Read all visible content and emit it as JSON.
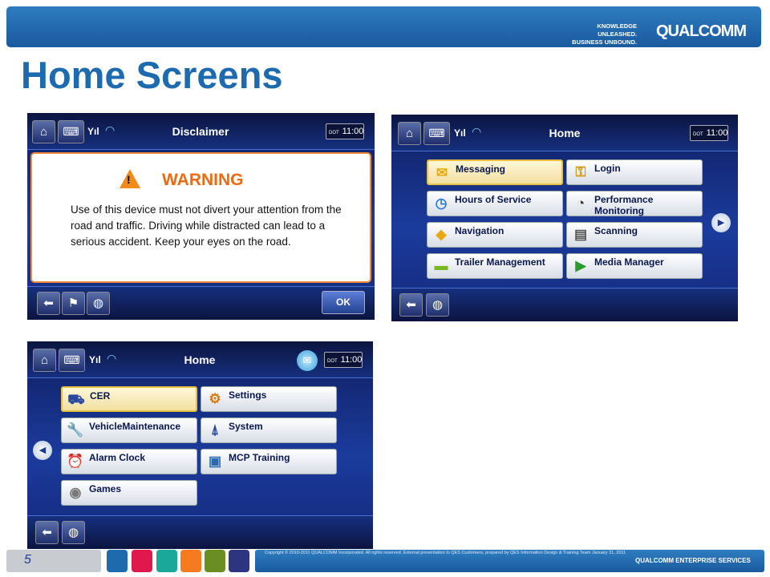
{
  "header": {
    "tagline_1": "KNOWLEDGE UNLEASHED.",
    "tagline_2": "BUSINESS UNBOUND.",
    "logo": "QUALCOMM"
  },
  "title": "Home Screens",
  "status": {
    "dot": "DOT",
    "time": "11:00"
  },
  "disclaimer": {
    "title": "Disclaimer",
    "warning_title": "WARNING",
    "warning_body": "Use of this device must not divert your attention from the road and traffic.  Driving while distracted can lead to a serious accident.  Keep your eyes on the road.",
    "ok_label": "OK"
  },
  "home1": {
    "title": "Home",
    "tiles": [
      "Messaging",
      "Login",
      "Hours of Service",
      "Performance Monitoring",
      "Navigation",
      "Scanning",
      "Trailer Management",
      "Media Manager"
    ]
  },
  "home2": {
    "title": "Home",
    "tiles": [
      "CER",
      "Settings",
      "VehicleMaintenance",
      "System",
      "Alarm Clock",
      "MCP Training",
      "Games"
    ]
  },
  "footer": {
    "page_number": "5",
    "copyright": "Copyright © 2010-2011 QUALCOMM Incorporated.  All rights reserved. External presentation to QES Customers, prepared by QES Information Design & Training Team January 31, 2011",
    "company": "QUALCOMM ENTERPRISE SERVICES"
  },
  "colors": {
    "brand_blue": "#1d6aaf",
    "warning_orange": "#ee6a10",
    "swatches": [
      "#1d6aaf",
      "#e0184b",
      "#1aa898",
      "#f47b20",
      "#6b8e23",
      "#2d3580"
    ]
  }
}
